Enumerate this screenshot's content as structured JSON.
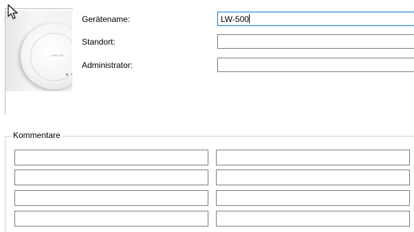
{
  "device": {
    "image_icon": "ceiling-access-point-image",
    "brand_text": "LANCOM"
  },
  "form": {
    "device_name_label": "Gerätename:",
    "device_name_value": "LW-500",
    "location_label": "Standort:",
    "location_value": "",
    "administrator_label": "Administrator:",
    "administrator_value": ""
  },
  "comments": {
    "legend": "Kommentare",
    "fields": [
      "",
      "",
      "",
      "",
      "",
      "",
      "",
      ""
    ]
  },
  "cursor": {
    "icon": "arrow-pointer-icon"
  },
  "colors": {
    "focus_border": "#0078d7",
    "field_border": "#7a7a7a"
  }
}
